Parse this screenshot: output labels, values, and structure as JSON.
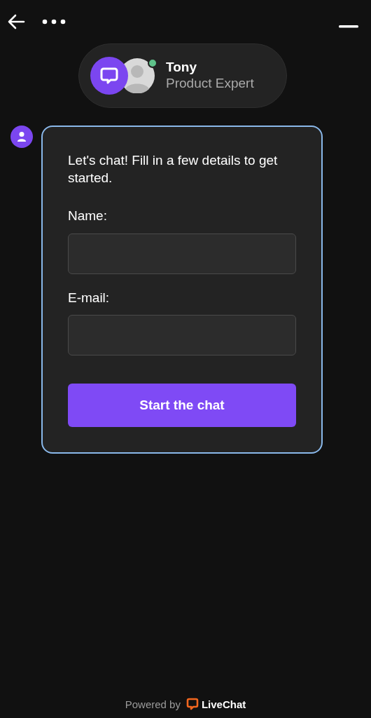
{
  "agent": {
    "name": "Tony",
    "role": "Product Expert",
    "online": true
  },
  "form": {
    "intro": "Let's chat! Fill in a few details to get started.",
    "fields": [
      {
        "label": "Name:"
      },
      {
        "label": "E-mail:"
      }
    ],
    "submit": "Start the chat"
  },
  "footer": {
    "prefix": "Powered by",
    "brand": "LiveChat"
  }
}
